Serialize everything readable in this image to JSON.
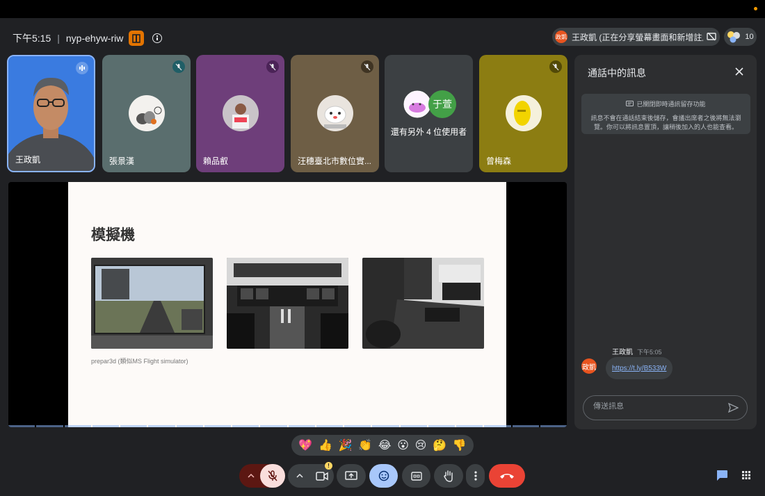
{
  "header": {
    "time": "下午5:15",
    "separator": "|",
    "meeting_code": "nyp-ehyw-riw",
    "presenter_avatar": "政凱",
    "presenter_text": "王政凱 (正在分享螢幕畫面和新增註解)",
    "participant_count": "10"
  },
  "tiles": [
    {
      "name": "王政凱",
      "mic": "speaking-icon"
    },
    {
      "name": "張景漢",
      "mic": "mic-off-icon"
    },
    {
      "name": "賴品叡",
      "mic": "mic-off-icon"
    },
    {
      "name": "汪穗臺北市數位實...",
      "mic": "mic-off-icon"
    },
    {
      "name": "還有另外 4 位使用者",
      "avatar_letter": "于萱"
    },
    {
      "name": "曾梅森",
      "mic": "mic-off-icon"
    }
  ],
  "slide": {
    "title": "模擬機",
    "caption": "prepar3d (類似MS Flight simulator)"
  },
  "chat": {
    "title": "通話中的訊息",
    "notice_title": "已關閉即時通訊留存功能",
    "notice_body": "訊息不會在通話結束後儲存，會議出席者之後將無法瀏覽。你可以將訊息置頂，讓稍後加入的人也能查看。",
    "messages": [
      {
        "sender": "王政凱",
        "time": "下午5:05",
        "avatar": "政凱",
        "link": "https://t.ly/B533W"
      }
    ],
    "input_placeholder": "傳送訊息"
  },
  "reactions": [
    "💖",
    "👍",
    "🎉",
    "👏",
    "😂",
    "😮",
    "😢",
    "🤔",
    "👎"
  ],
  "controls": {
    "camera_warning": "!",
    "colors": {
      "end_call": "#ea4335",
      "mic_off": "#f9dedc",
      "emoji_active": "#a8c7fa"
    }
  }
}
